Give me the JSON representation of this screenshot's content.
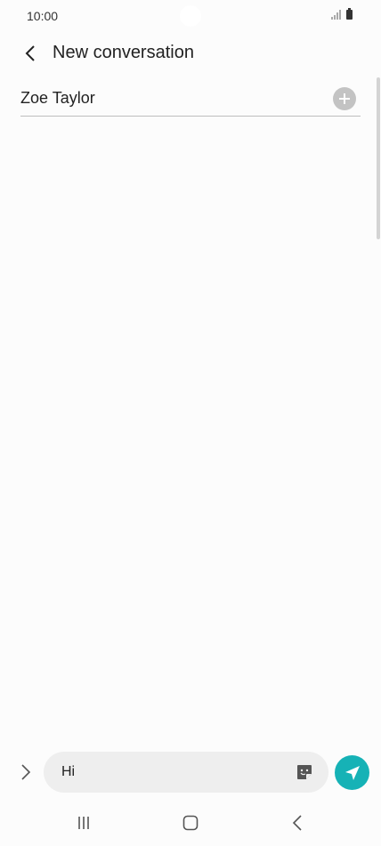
{
  "status_bar": {
    "time": "10:00",
    "icons": [
      "signal-icon",
      "battery-icon"
    ]
  },
  "header": {
    "back_icon": "chevron-left-icon",
    "title": "New conversation"
  },
  "recipient": {
    "name": "Zoe Taylor",
    "add_icon": "plus-circle-icon"
  },
  "composer": {
    "expand_icon": "chevron-right-icon",
    "message": "Hi",
    "sticker_icon": "sticker-icon",
    "send_icon": "send-icon",
    "send_color": "#16b2b6"
  },
  "nav_bar": {
    "icons": [
      "recents-icon",
      "home-icon",
      "back-icon"
    ]
  }
}
